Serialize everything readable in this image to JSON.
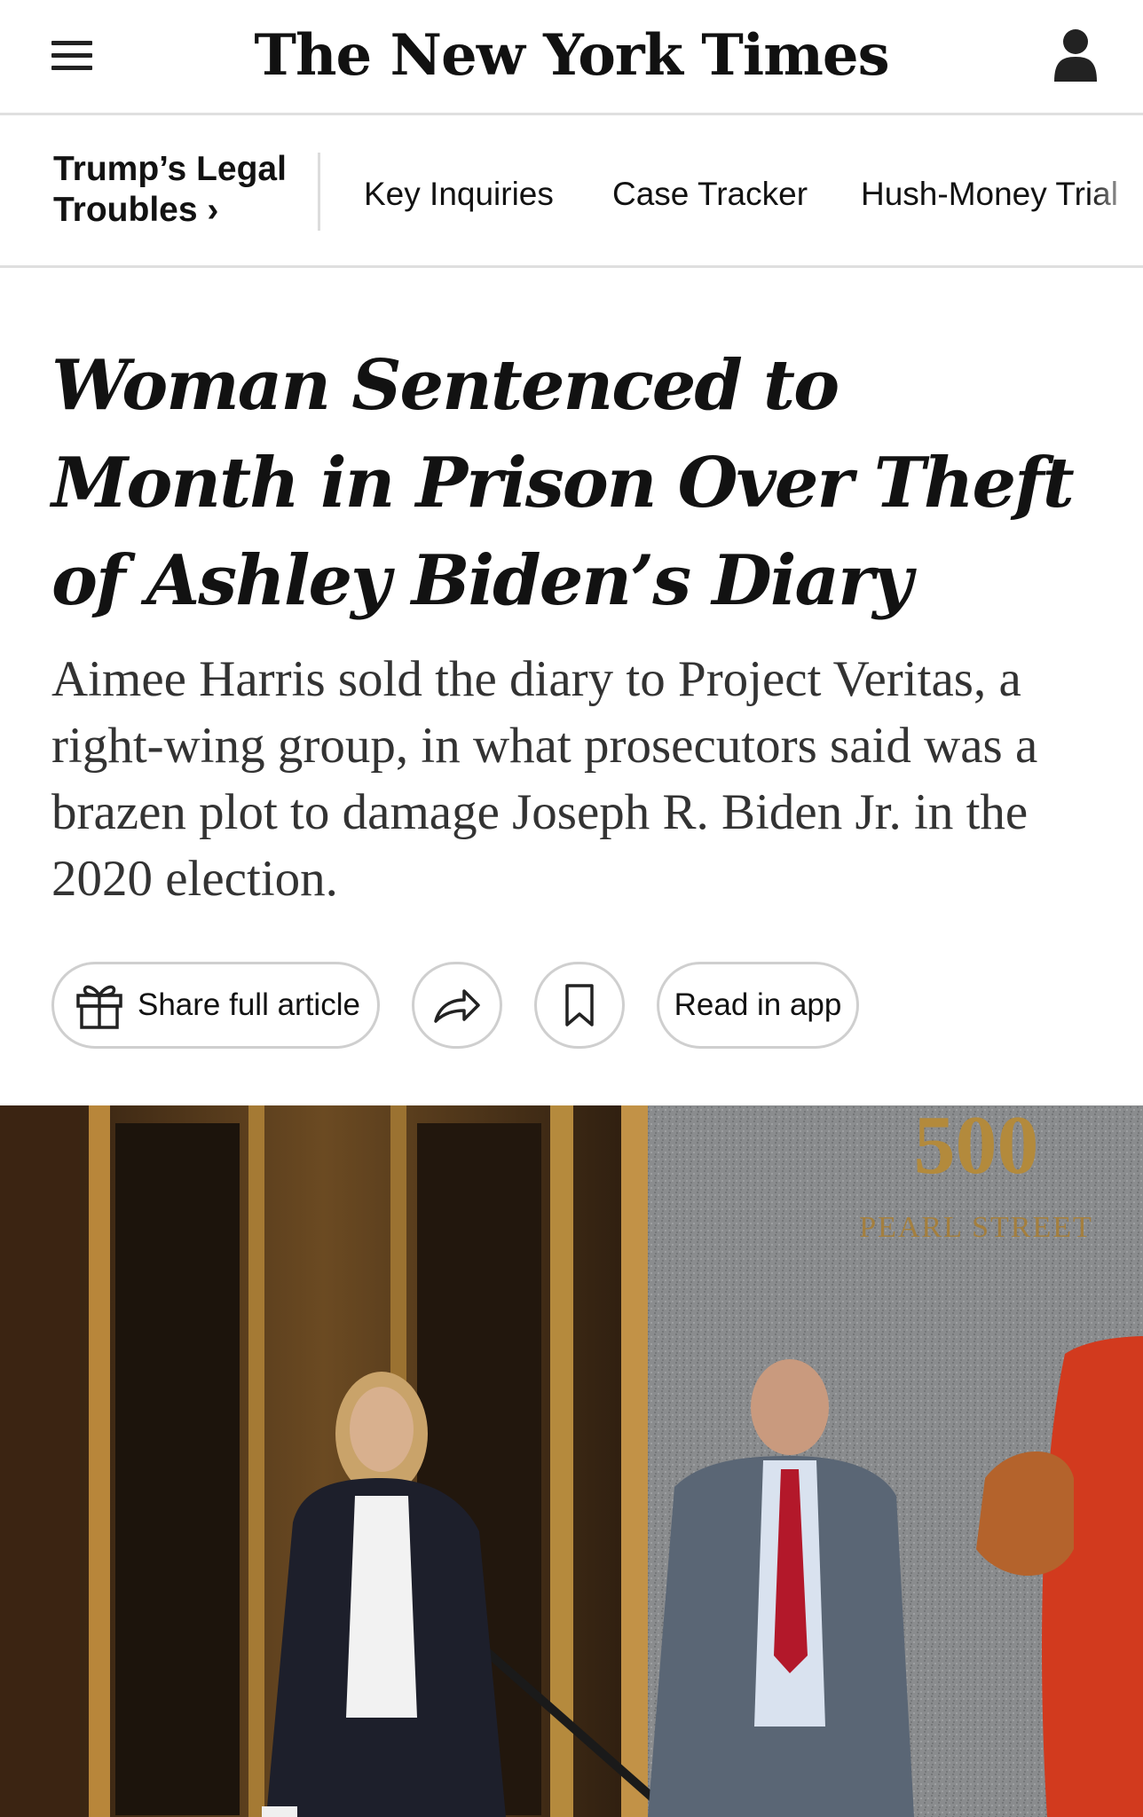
{
  "header": {
    "menu_icon": "hamburger-menu-icon",
    "masthead": "The New York Times",
    "account_icon": "person-account-icon"
  },
  "section_nav": {
    "title": "Trump’s Legal Troubles ›",
    "links": [
      "Key Inquiries",
      "Case Tracker",
      "Hush-Money Trial"
    ]
  },
  "article": {
    "headline": "Woman Sentenced to Month in Prison Over Theft of Ashley Biden’s Diary",
    "summary": "Aimee Harris sold the diary to Project Veritas, a right-wing group, in what prosecutors said was a brazen plot to damage Joseph R. Biden Jr. in the 2020 election."
  },
  "actions": {
    "share_label": "Share full article",
    "share_icon": "gift-icon",
    "forward_icon": "share-arrow-icon",
    "save_icon": "bookmark-icon",
    "read_in_app_label": "Read in app"
  },
  "photo": {
    "sign_number": "500",
    "sign_street": "PEARL STREET"
  }
}
